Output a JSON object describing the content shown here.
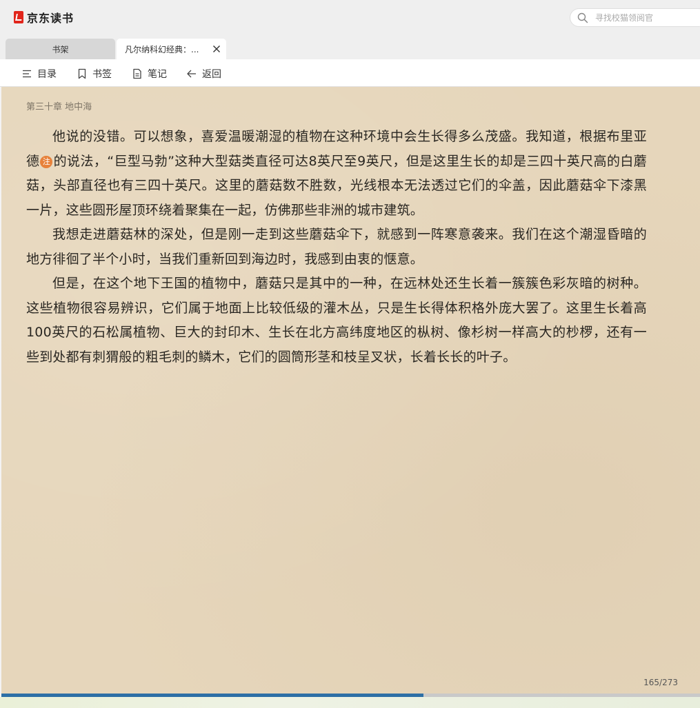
{
  "app": {
    "title": "京东读书"
  },
  "search": {
    "placeholder": "寻找校猫领阅官"
  },
  "tabs": [
    {
      "label": "书架"
    },
    {
      "label": "凡尔纳科幻经典：..."
    }
  ],
  "toolbar": {
    "toc_label": "目录",
    "bookmark_label": "书签",
    "notes_label": "笔记",
    "back_label": "返回"
  },
  "reader": {
    "chapter_title": "第三十章 地中海",
    "paragraphs": [
      {
        "text_a": "他说的没错。可以想象，喜爱温暖潮湿的植物在这种环境中会生长得多么茂盛。我知道，根据布里亚德",
        "note_badge": "注",
        "text_b": "的说法，“巨型马勃”这种大型菇类直径可达8英尺至9英尺，但是这里生长的却是三四十英尺高的白蘑菇，头部直径也有三四十英尺。这里的蘑菇数不胜数，光线根本无法透过它们的伞盖，因此蘑菇伞下漆黑一片，这些圆形屋顶环绕着聚集在一起，仿佛那些非洲的城市建筑。"
      },
      {
        "text": "我想走进蘑菇林的深处，但是刚一走到这些蘑菇伞下，就感到一阵寒意袭来。我们在这个潮湿昏暗的地方徘徊了半个小时，当我们重新回到海边时，我感到由衷的惬意。"
      },
      {
        "text": "但是，在这个地下王国的植物中，蘑菇只是其中的一种，在远林处还生长着一簇簇色彩灰暗的树种。这些植物很容易辨识，它们属于地面上比较低级的灌木丛，只是生长得体积格外庞大罢了。这里生长着高100英尺的石松属植物、巨大的封印木、生长在北方高纬度地区的枞树、像杉树一样高大的杪椤，还有一些到处都有刺猬般的粗毛刺的鳞木，它们的圆筒形茎和枝呈叉状，长着长长的叶子。"
      }
    ],
    "page_indicator": "165/273",
    "reading_progress": 0.604
  },
  "colors": {
    "brand": "#e1251b",
    "paper": "#e6d6bb",
    "note_badge": "#e7813a",
    "progress": "#2d6fa6"
  },
  "icons": [
    "logo-icon",
    "search-icon",
    "close-icon",
    "toc-icon",
    "bookmark-icon",
    "notes-icon",
    "back-arrow-icon"
  ]
}
